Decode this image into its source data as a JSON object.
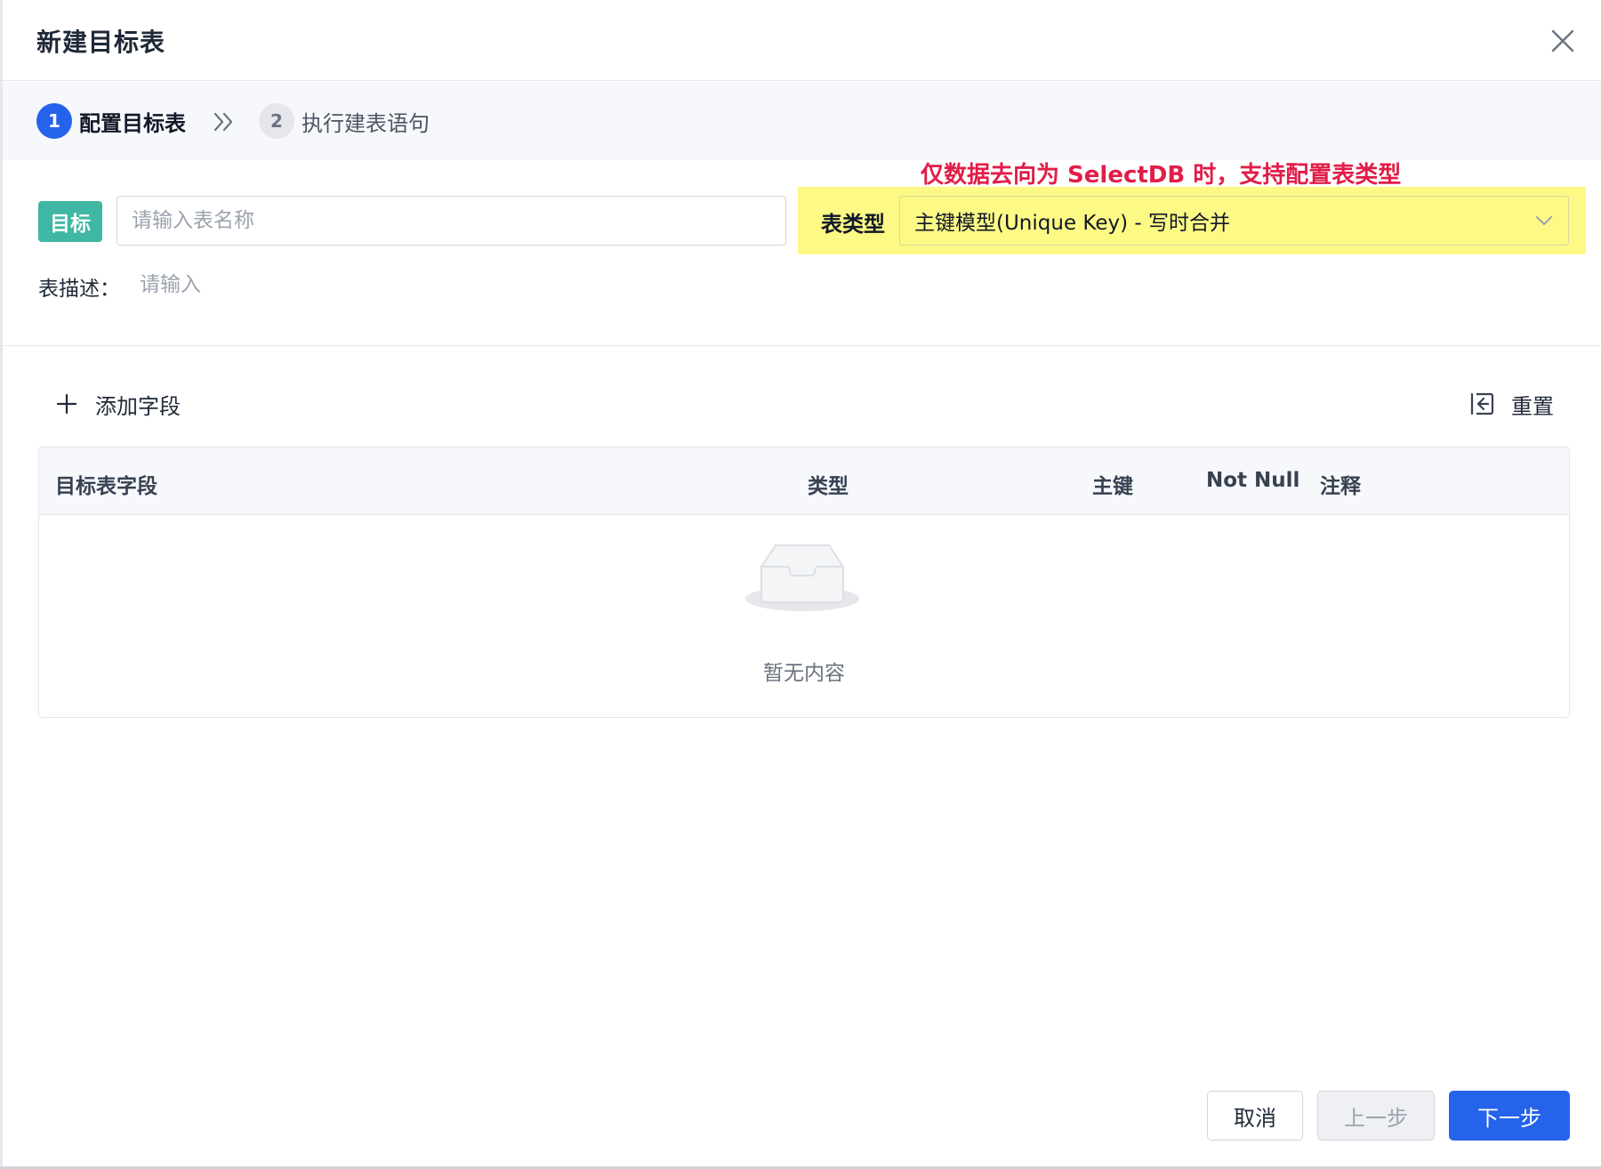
{
  "dialog": {
    "title": "新建目标表",
    "close_icon": "close-icon"
  },
  "steps": [
    {
      "number": "1",
      "label": "配置目标表",
      "state": "active"
    },
    {
      "number": "2",
      "label": "执行建表语句",
      "state": "pending"
    }
  ],
  "annotation": "仅数据去向为 SelectDB 时，支持配置表类型",
  "form": {
    "target_tag": "目标",
    "table_name_placeholder": "请输入表名称",
    "table_type_label": "表类型",
    "table_type_value": "主键模型(Unique Key) - 写时合并",
    "description_label": "表描述：",
    "description_placeholder": "请输入"
  },
  "toolbar": {
    "add_field_label": "添加字段",
    "reset_label": "重置"
  },
  "table": {
    "columns": [
      "目标表字段",
      "类型",
      "主键",
      "Not Null",
      "注释"
    ],
    "rows": [],
    "empty_text": "暂无内容"
  },
  "footer": {
    "cancel_label": "取消",
    "prev_label": "上一步",
    "next_label": "下一步"
  },
  "colors": {
    "primary": "#2563eb",
    "target_tag": "#3fb7a3",
    "highlight": "#fdf985",
    "annotation": "#e11d48"
  }
}
